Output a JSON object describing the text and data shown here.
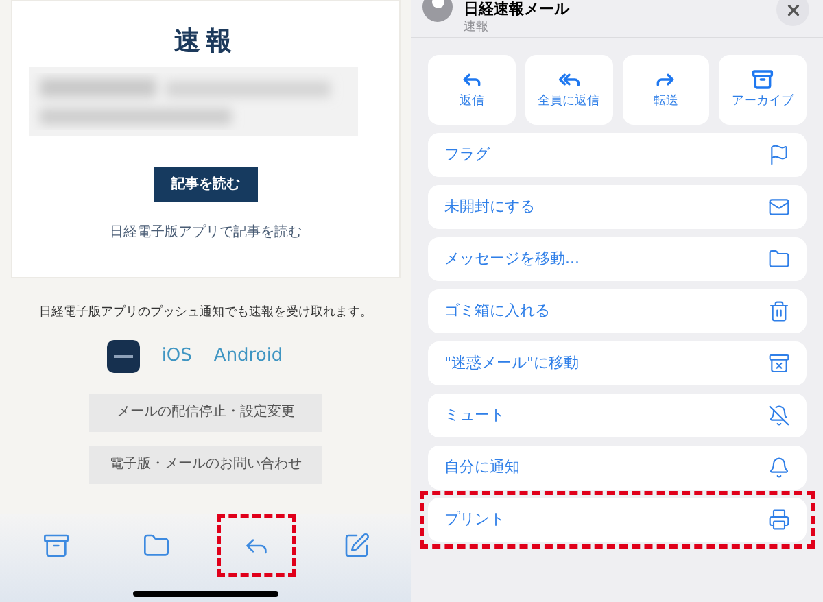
{
  "email": {
    "title": "速報",
    "read_button": "記事を読む",
    "app_link": "日経電子版アプリで記事を読む",
    "push_text": "日経電子版アプリのプッシュ通知でも速報を受け取れます。",
    "store_links": [
      "iOS",
      "Android"
    ],
    "buttons": [
      "メールの配信停止・設定変更",
      "電子版・メールのお問い合わせ"
    ]
  },
  "toolbar": [
    {
      "kind": "archive",
      "highlighted": false
    },
    {
      "kind": "folder",
      "highlighted": false
    },
    {
      "kind": "reply",
      "highlighted": true
    },
    {
      "kind": "compose",
      "highlighted": false
    }
  ],
  "sheet": {
    "sender": "日経速報メール",
    "subject": "速報",
    "actions": [
      {
        "kind": "reply",
        "label": "返信"
      },
      {
        "kind": "reply_all",
        "label": "全員に返信"
      },
      {
        "kind": "forward",
        "label": "転送"
      },
      {
        "kind": "archive",
        "label": "アーカイブ"
      }
    ],
    "menu": [
      {
        "kind": "flag",
        "label": "フラグ",
        "highlighted": false
      },
      {
        "kind": "unread",
        "label": "未開封にする",
        "highlighted": false
      },
      {
        "kind": "move",
        "label": "メッセージを移動...",
        "highlighted": false
      },
      {
        "kind": "trash",
        "label": "ゴミ箱に入れる",
        "highlighted": false
      },
      {
        "kind": "junk",
        "label": "\"迷惑メール\"に移動",
        "highlighted": false
      },
      {
        "kind": "mute",
        "label": "ミュート",
        "highlighted": false
      },
      {
        "kind": "notify",
        "label": "自分に通知",
        "highlighted": false
      },
      {
        "kind": "print",
        "label": "プリント",
        "highlighted": true
      }
    ]
  }
}
